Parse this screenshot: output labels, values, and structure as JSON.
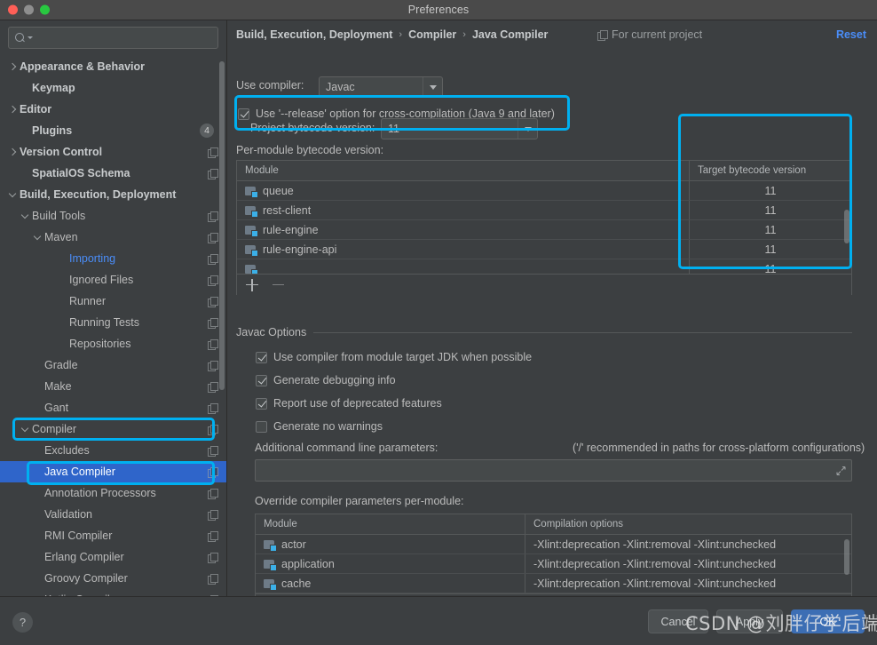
{
  "window": {
    "title": "Preferences",
    "traffic_lights": [
      "close-red",
      "minimize-gray",
      "zoom-green"
    ]
  },
  "sidebar": {
    "search": {
      "value": "",
      "placeholder": ""
    },
    "items": [
      {
        "label": "Appearance & Behavior",
        "indent": 0,
        "arrow": "right",
        "bold": true,
        "copy": false,
        "badge": ""
      },
      {
        "label": "Keymap",
        "indent": 1,
        "arrow": "none",
        "bold": true,
        "copy": false,
        "badge": ""
      },
      {
        "label": "Editor",
        "indent": 0,
        "arrow": "right",
        "bold": true,
        "copy": false,
        "badge": ""
      },
      {
        "label": "Plugins",
        "indent": 1,
        "arrow": "none",
        "bold": true,
        "copy": false,
        "badge": "4"
      },
      {
        "label": "Version Control",
        "indent": 0,
        "arrow": "right",
        "bold": true,
        "copy": true,
        "badge": ""
      },
      {
        "label": "SpatialOS Schema",
        "indent": 1,
        "arrow": "none",
        "bold": true,
        "copy": true,
        "badge": ""
      },
      {
        "label": "Build, Execution, Deployment",
        "indent": 0,
        "arrow": "down",
        "bold": true,
        "copy": false,
        "badge": ""
      },
      {
        "label": "Build Tools",
        "indent": 1,
        "arrow": "down",
        "bold": false,
        "copy": true,
        "badge": ""
      },
      {
        "label": "Maven",
        "indent": 2,
        "arrow": "down",
        "bold": false,
        "copy": true,
        "badge": ""
      },
      {
        "label": "Importing",
        "indent": 4,
        "arrow": "none",
        "bold": false,
        "copy": true,
        "badge": "",
        "linked": true
      },
      {
        "label": "Ignored Files",
        "indent": 4,
        "arrow": "none",
        "bold": false,
        "copy": true,
        "badge": ""
      },
      {
        "label": "Runner",
        "indent": 4,
        "arrow": "none",
        "bold": false,
        "copy": true,
        "badge": ""
      },
      {
        "label": "Running Tests",
        "indent": 4,
        "arrow": "none",
        "bold": false,
        "copy": true,
        "badge": ""
      },
      {
        "label": "Repositories",
        "indent": 4,
        "arrow": "none",
        "bold": false,
        "copy": true,
        "badge": ""
      },
      {
        "label": "Gradle",
        "indent": 2,
        "arrow": "none",
        "bold": false,
        "copy": true,
        "badge": ""
      },
      {
        "label": "Make",
        "indent": 2,
        "arrow": "none",
        "bold": false,
        "copy": true,
        "badge": ""
      },
      {
        "label": "Gant",
        "indent": 2,
        "arrow": "none",
        "bold": false,
        "copy": true,
        "badge": ""
      },
      {
        "label": "Compiler",
        "indent": 1,
        "arrow": "down",
        "bold": false,
        "copy": true,
        "badge": ""
      },
      {
        "label": "Excludes",
        "indent": 2,
        "arrow": "none",
        "bold": false,
        "copy": true,
        "badge": ""
      },
      {
        "label": "Java Compiler",
        "indent": 2,
        "arrow": "none",
        "bold": false,
        "copy": true,
        "badge": "",
        "selected": true
      },
      {
        "label": "Annotation Processors",
        "indent": 2,
        "arrow": "none",
        "bold": false,
        "copy": true,
        "badge": ""
      },
      {
        "label": "Validation",
        "indent": 2,
        "arrow": "none",
        "bold": false,
        "copy": true,
        "badge": ""
      },
      {
        "label": "RMI Compiler",
        "indent": 2,
        "arrow": "none",
        "bold": false,
        "copy": true,
        "badge": ""
      },
      {
        "label": "Erlang Compiler",
        "indent": 2,
        "arrow": "none",
        "bold": false,
        "copy": true,
        "badge": ""
      },
      {
        "label": "Groovy Compiler",
        "indent": 2,
        "arrow": "none",
        "bold": false,
        "copy": true,
        "badge": ""
      },
      {
        "label": "Kotlin Compiler",
        "indent": 2,
        "arrow": "none",
        "bold": false,
        "copy": true,
        "badge": ""
      }
    ]
  },
  "header": {
    "breadcrumb": [
      "Build, Execution, Deployment",
      "Compiler",
      "Java Compiler"
    ],
    "separator": "›",
    "scope_label": "For current project",
    "reset_label": "Reset"
  },
  "main": {
    "use_compiler_label": "Use compiler:",
    "use_compiler_value": "Javac",
    "release_option_label": "Use '--release' option for cross-compilation (Java 9 and later)",
    "release_option_checked": true,
    "project_bytecode_label": "Project bytecode version:",
    "project_bytecode_value": "11",
    "per_module_label": "Per-module bytecode version:",
    "per_module_table": {
      "columns": [
        "Module",
        "Target bytecode version"
      ],
      "rows": [
        {
          "module": "queue",
          "version": "11"
        },
        {
          "module": "rest-client",
          "version": "11"
        },
        {
          "module": "rule-engine",
          "version": "11"
        },
        {
          "module": "rule-engine-api",
          "version": "11"
        }
      ],
      "add_label": "+",
      "remove_label": "−"
    },
    "javac_options": {
      "group_title": "Javac Options",
      "checkboxes": [
        {
          "label": "Use compiler from module target JDK when possible",
          "checked": true
        },
        {
          "label": "Generate debugging info",
          "checked": true
        },
        {
          "label": "Report use of deprecated features",
          "checked": true
        },
        {
          "label": "Generate no warnings",
          "checked": false
        }
      ],
      "additional_params_label": "Additional command line parameters:",
      "additional_params_hint": "('/' recommended in paths for cross-platform configurations)",
      "additional_params_value": ""
    },
    "override_label": "Override compiler parameters per-module:",
    "override_table": {
      "columns": [
        "Module",
        "Compilation options"
      ],
      "rows": [
        {
          "module": "actor",
          "options": "-Xlint:deprecation -Xlint:removal -Xlint:unchecked"
        },
        {
          "module": "application",
          "options": "-Xlint:deprecation -Xlint:removal -Xlint:unchecked"
        },
        {
          "module": "cache",
          "options": "-Xlint:deprecation -Xlint:removal -Xlint:unchecked"
        }
      ],
      "add_label": "+",
      "remove_label": "−"
    }
  },
  "footer": {
    "help_label": "?",
    "cancel_label": "Cancel",
    "apply_label": "Apply",
    "ok_label": "OK"
  },
  "overlay": {
    "watermark": "CSDN @刘胖仔学后端"
  },
  "colors": {
    "accent_blue": "#4a8df8",
    "highlight_cyan": "#00b0f0",
    "selection_blue": "#2f65ca",
    "primary_button": "#3c6eb4",
    "panel_bg": "#3c3f41",
    "field_bg": "#45494a"
  }
}
